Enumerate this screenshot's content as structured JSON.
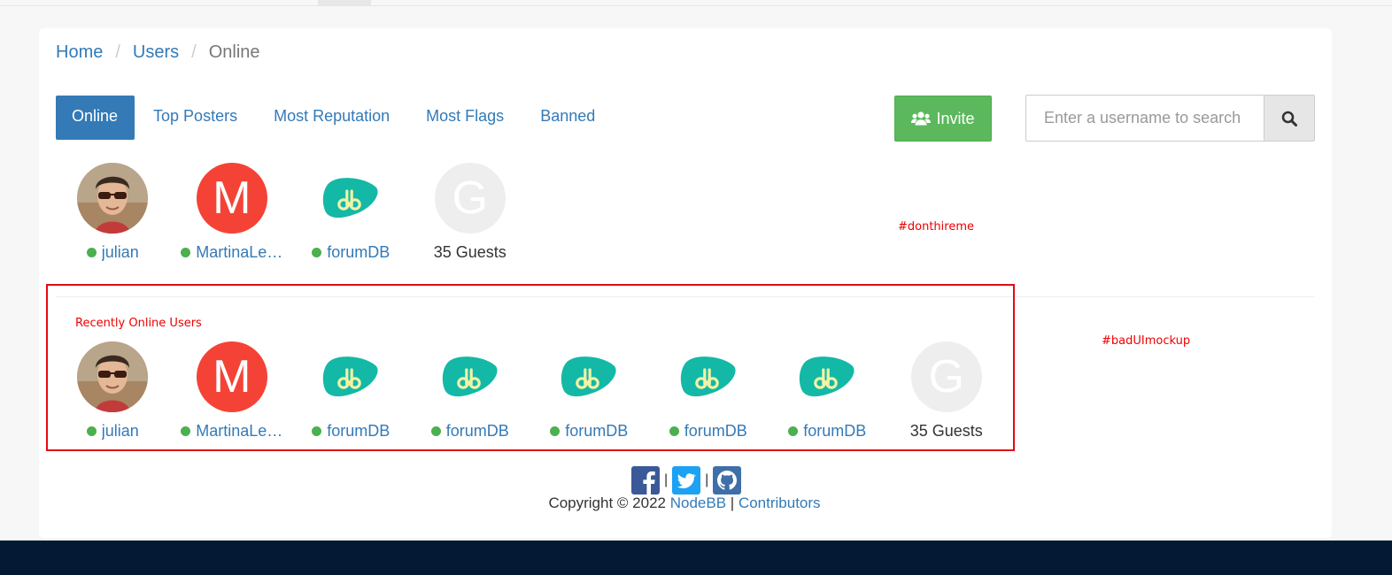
{
  "breadcrumb": {
    "home": "Home",
    "users": "Users",
    "current": "Online"
  },
  "tabs": [
    {
      "label": "Online",
      "active": true
    },
    {
      "label": "Top Posters"
    },
    {
      "label": "Most Reputation"
    },
    {
      "label": "Most Flags"
    },
    {
      "label": "Banned"
    }
  ],
  "invite": {
    "label": "Invite"
  },
  "search": {
    "placeholder": "Enter a username to search"
  },
  "online_users": {
    "users": [
      "julian",
      "MartinaLe…",
      "forumDB"
    ],
    "guests": "35 Guests"
  },
  "annotations": {
    "hashtag_top": "#donthireme",
    "hashtag_bottom": "#badUImockup",
    "recent_title": "Recently Online Users"
  },
  "recent_users": {
    "users": [
      "julian",
      "MartinaLe…",
      "forumDB",
      "forumDB",
      "forumDB",
      "forumDB",
      "forumDB"
    ],
    "guests": "35 Guests"
  },
  "footer": {
    "copyright": "Copyright © 2022",
    "nodebb": "NodeBB",
    "separator": "|",
    "contributors": "Contributors"
  },
  "colors": {
    "primary": "#337ab7",
    "success": "#5cb85c",
    "online_dot": "#4caf50",
    "annotation": "#e00"
  },
  "icons": [
    "users-icon",
    "search-icon",
    "facebook-icon",
    "twitter-icon",
    "github-icon",
    "forumdb-logo-icon"
  ]
}
